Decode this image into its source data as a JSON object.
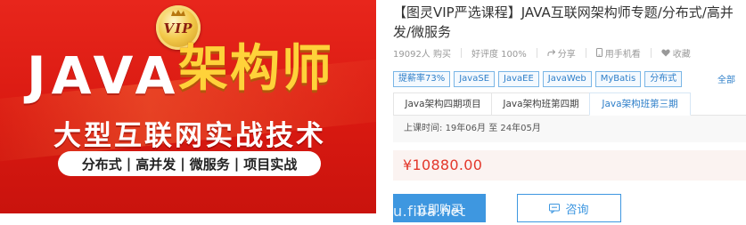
{
  "banner": {
    "vip_badge": "VIP",
    "java_word": "JAVA",
    "java_cn": "架构师",
    "subtitle": "大型互联网实战技术",
    "features": [
      "分布式",
      "高并发",
      "微服务",
      "项目实战"
    ],
    "separator": "|",
    "colors": {
      "bg": "#d91911",
      "accent": "#ffd23a"
    }
  },
  "course": {
    "title": "【图灵VIP严选课程】JAVA互联网架构师专题/分布式/高并发/微服务",
    "buyers": "19092人 购买",
    "rating": "好评度 100%",
    "share": {
      "icon": "share-icon",
      "label": "分享"
    },
    "mobile": {
      "icon": "phone-icon",
      "label": "用手机看"
    },
    "favorite": {
      "icon": "heart-icon",
      "label": "收藏"
    },
    "tags": [
      "提薪率73%",
      "JavaSE",
      "JavaEE",
      "JavaWeb",
      "MyBatis",
      "分布式"
    ],
    "all_link": "全部",
    "periods": [
      {
        "label": "Java架构四期项目",
        "active": false
      },
      {
        "label": "Java架构班第四期",
        "active": false
      },
      {
        "label": "Java架构班第三期",
        "active": true
      }
    ],
    "time_label": "上课时间:",
    "time_range": "19年06月 至 24年05月",
    "price": "¥10880.00",
    "buy_label": "立即购买",
    "consult_label": "咨询",
    "watermark": "u.fiba.net"
  }
}
